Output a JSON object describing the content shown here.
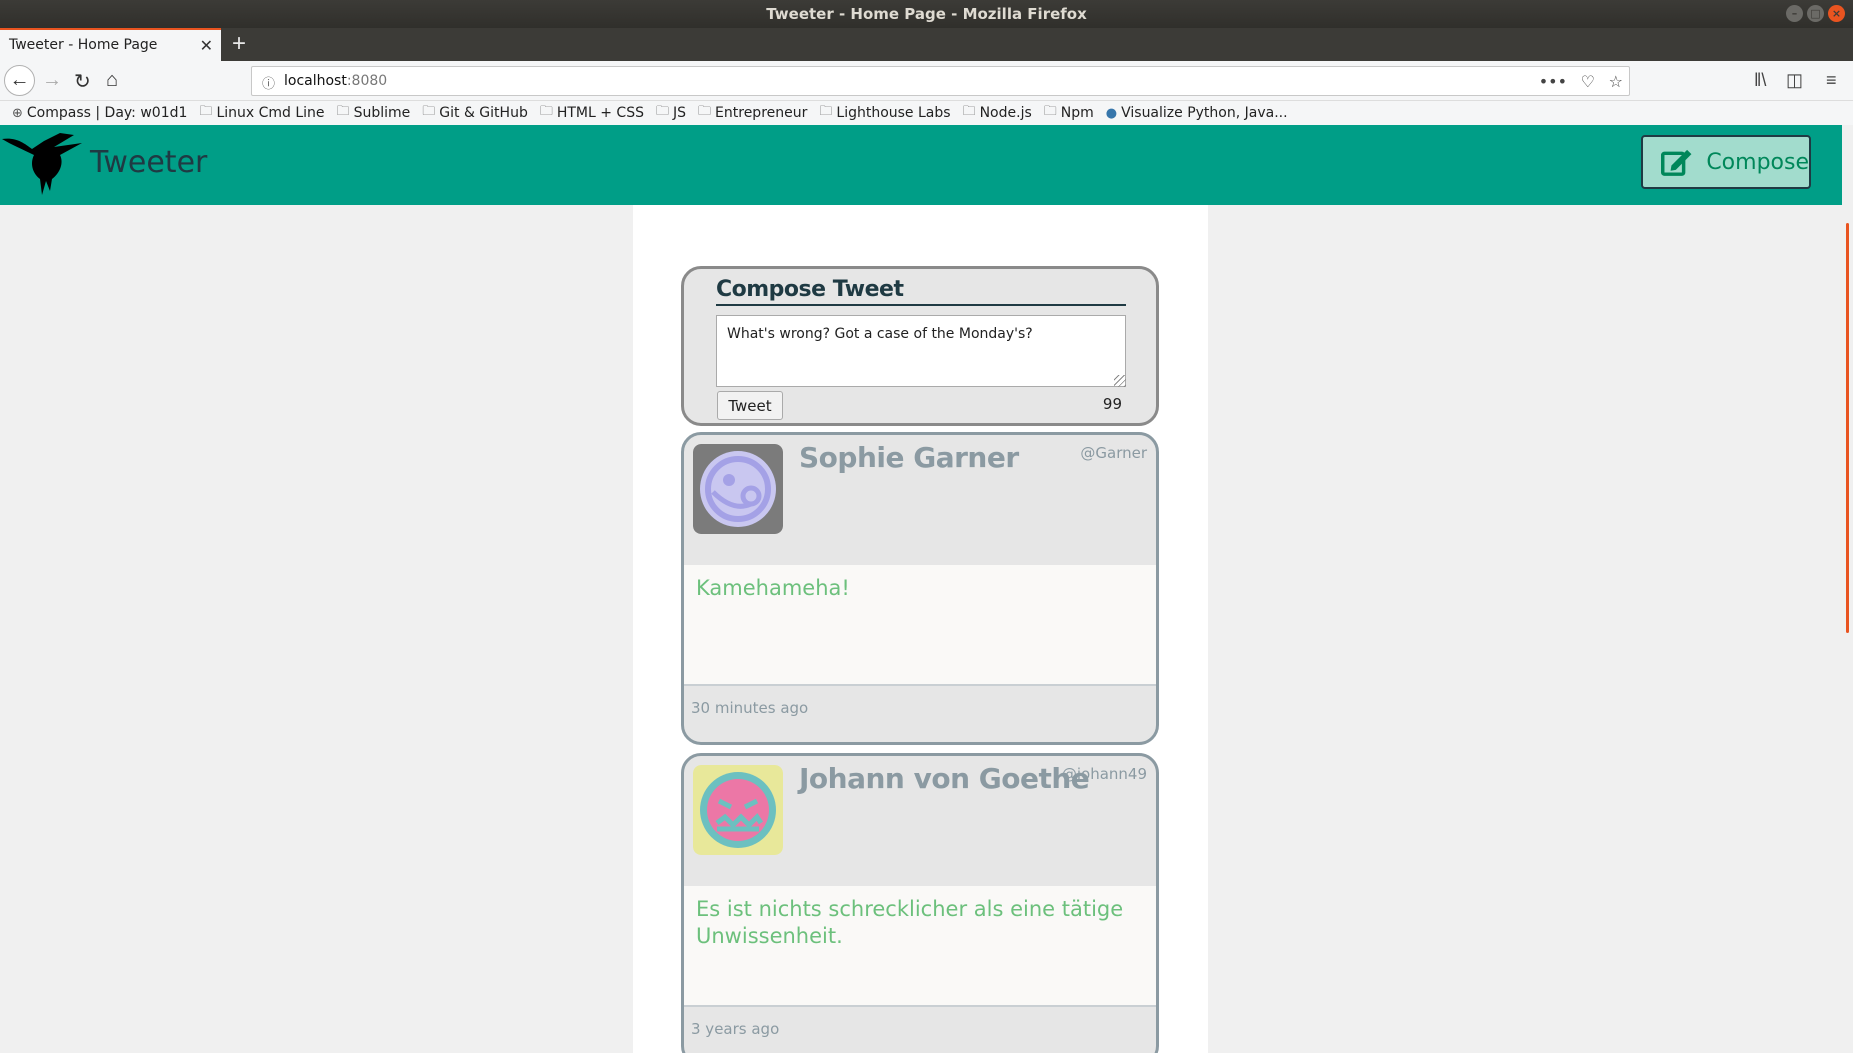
{
  "window": {
    "title": "Tweeter - Home Page - Mozilla Firefox"
  },
  "browser": {
    "tab_title": "Tweeter - Home Page",
    "url_host": "localhost",
    "url_port": ":8080",
    "bookmarks": [
      {
        "label": "Compass | Day: w01d1",
        "icon": "compass-icon"
      },
      {
        "label": "Linux Cmd Line",
        "icon": "folder-icon"
      },
      {
        "label": "Sublime",
        "icon": "folder-icon"
      },
      {
        "label": "Git & GitHub",
        "icon": "folder-icon"
      },
      {
        "label": "HTML + CSS",
        "icon": "folder-icon"
      },
      {
        "label": "JS",
        "icon": "folder-icon"
      },
      {
        "label": "Entrepreneur",
        "icon": "folder-icon"
      },
      {
        "label": "Lighthouse Labs",
        "icon": "folder-icon"
      },
      {
        "label": "Node.js",
        "icon": "folder-icon"
      },
      {
        "label": "Npm",
        "icon": "folder-icon"
      },
      {
        "label": "Visualize Python, Java...",
        "icon": "python-icon"
      }
    ]
  },
  "site": {
    "title": "Tweeter",
    "compose_label": "Compose",
    "brand_color": "#009e87"
  },
  "new_tweet": {
    "heading": "Compose Tweet",
    "text": "What's wrong? Got a case of the Monday's?",
    "button_label": "Tweet",
    "counter": "99"
  },
  "tweets": [
    {
      "name": "Sophie Garner",
      "handle": "@Garner",
      "content": "Kamehameha!",
      "time": "30 minutes ago",
      "avatar_colors": {
        "bg": "#7b7b7b",
        "face": "#c9c7f0",
        "stroke": "#a4a1e6"
      }
    },
    {
      "name": "Johann von Goethe",
      "handle": "@johann49",
      "content": "Es ist nichts schrecklicher als eine tätige Unwissenheit.",
      "time": "3 years ago",
      "avatar_colors": {
        "bg": "#e8e89a",
        "face": "#ec77a6",
        "stroke": "#6cc0c0"
      }
    }
  ]
}
